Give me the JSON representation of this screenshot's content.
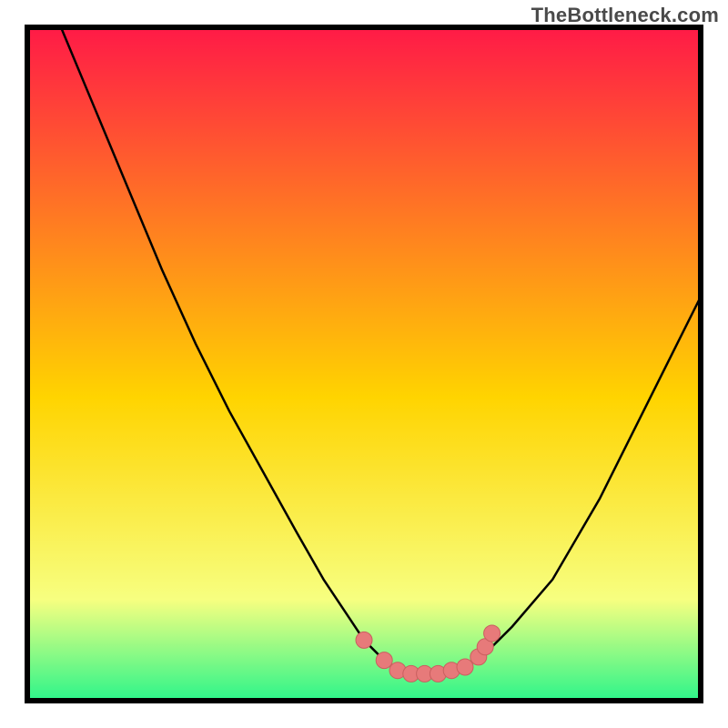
{
  "watermark": "TheBottleneck.com",
  "colors": {
    "gradient_top": "#ff1a47",
    "gradient_mid": "#ffd400",
    "gradient_low": "#f7ff80",
    "gradient_bottom": "#2cf58a",
    "frame": "#000000",
    "curve": "#000000",
    "marker_fill": "#e77a7a",
    "marker_stroke": "#c95f5f"
  },
  "chart_data": {
    "type": "line",
    "title": "",
    "xlabel": "",
    "ylabel": "",
    "xlim": [
      0,
      100
    ],
    "ylim": [
      0,
      100
    ],
    "grid": false,
    "legend": false,
    "series": [
      {
        "name": "bottleneck-curve",
        "x": [
          5,
          10,
          15,
          20,
          25,
          30,
          35,
          40,
          44,
          48,
          50,
          53,
          56,
          58,
          60,
          62,
          65,
          68,
          72,
          78,
          85,
          92,
          100
        ],
        "y": [
          100,
          88,
          76,
          64,
          53,
          43,
          34,
          25,
          18,
          12,
          9,
          6,
          4,
          4,
          4,
          4,
          5,
          7,
          11,
          18,
          30,
          44,
          60
        ]
      }
    ],
    "markers": [
      {
        "x": 50,
        "y": 9
      },
      {
        "x": 53,
        "y": 6
      },
      {
        "x": 55,
        "y": 4.5
      },
      {
        "x": 57,
        "y": 4
      },
      {
        "x": 59,
        "y": 4
      },
      {
        "x": 61,
        "y": 4
      },
      {
        "x": 63,
        "y": 4.5
      },
      {
        "x": 65,
        "y": 5
      },
      {
        "x": 67,
        "y": 6.5
      },
      {
        "x": 68,
        "y": 8
      },
      {
        "x": 69,
        "y": 10
      }
    ]
  }
}
